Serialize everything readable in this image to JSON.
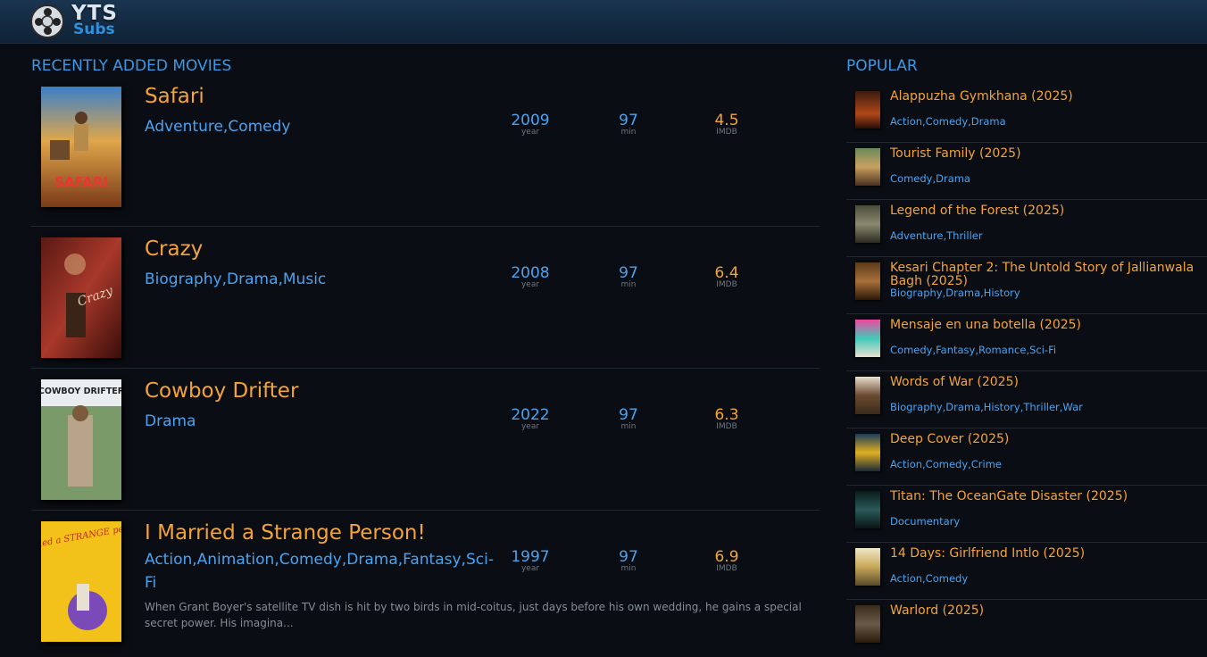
{
  "site": {
    "logo_main": "YTS",
    "logo_sub": "Subs"
  },
  "recent": {
    "title": "RECENTLY ADDED MOVIES",
    "movies": [
      {
        "title": "Safari",
        "genres": "Adventure,Comedy",
        "year": "2009",
        "year_label": "year",
        "runtime": "97",
        "runtime_label": "min",
        "rating": "4.5",
        "rating_label": "IMDB",
        "description": "",
        "poster_text": "SAFARI"
      },
      {
        "title": "Crazy",
        "genres": "Biography,Drama,Music",
        "year": "2008",
        "year_label": "year",
        "runtime": "97",
        "runtime_label": "min",
        "rating": "6.4",
        "rating_label": "IMDB",
        "description": "",
        "poster_text": "Crazy"
      },
      {
        "title": "Cowboy Drifter",
        "genres": "Drama",
        "year": "2022",
        "year_label": "year",
        "runtime": "97",
        "runtime_label": "min",
        "rating": "6.3",
        "rating_label": "IMDB",
        "description": "",
        "poster_text": "COWBOY DRIFTER"
      },
      {
        "title": "I Married a Strange Person!",
        "genres": "Action,Animation,Comedy,Drama,Fantasy,Sci-Fi",
        "year": "1997",
        "year_label": "year",
        "runtime": "97",
        "runtime_label": "min",
        "rating": "6.9",
        "rating_label": "IMDB",
        "description": "When Grant Boyer's satellite TV dish is hit by two birds in mid-coitus, just days before his own wedding, he gains a special secret power. His imagina...",
        "poster_text": "i married a STRANGE person!"
      }
    ]
  },
  "popular": {
    "title": "POPULAR",
    "items": [
      {
        "title": "Alappuzha Gymkhana (2025)",
        "genres": "Action,Comedy,Drama"
      },
      {
        "title": "Tourist Family (2025)",
        "genres": "Comedy,Drama"
      },
      {
        "title": "Legend of the Forest (2025)",
        "genres": "Adventure,Thriller"
      },
      {
        "title": "Kesari Chapter 2: The Untold Story of Jallianwala Bagh (2025)",
        "genres": "Biography,Drama,History"
      },
      {
        "title": "Mensaje en una botella (2025)",
        "genres": "Comedy,Fantasy,Romance,Sci-Fi"
      },
      {
        "title": "Words of War (2025)",
        "genres": "Biography,Drama,History,Thriller,War"
      },
      {
        "title": "Deep Cover (2025)",
        "genres": "Action,Comedy,Crime"
      },
      {
        "title": "Titan: The OceanGate Disaster (2025)",
        "genres": "Documentary"
      },
      {
        "title": "14 Days: Girlfriend Intlo (2025)",
        "genres": "Action,Comedy"
      },
      {
        "title": "Warlord (2025)",
        "genres": ""
      }
    ]
  },
  "colors": {
    "accent_blue": "#3c98e6",
    "accent_orange": "#f4a338",
    "background": "#0a0e14"
  }
}
